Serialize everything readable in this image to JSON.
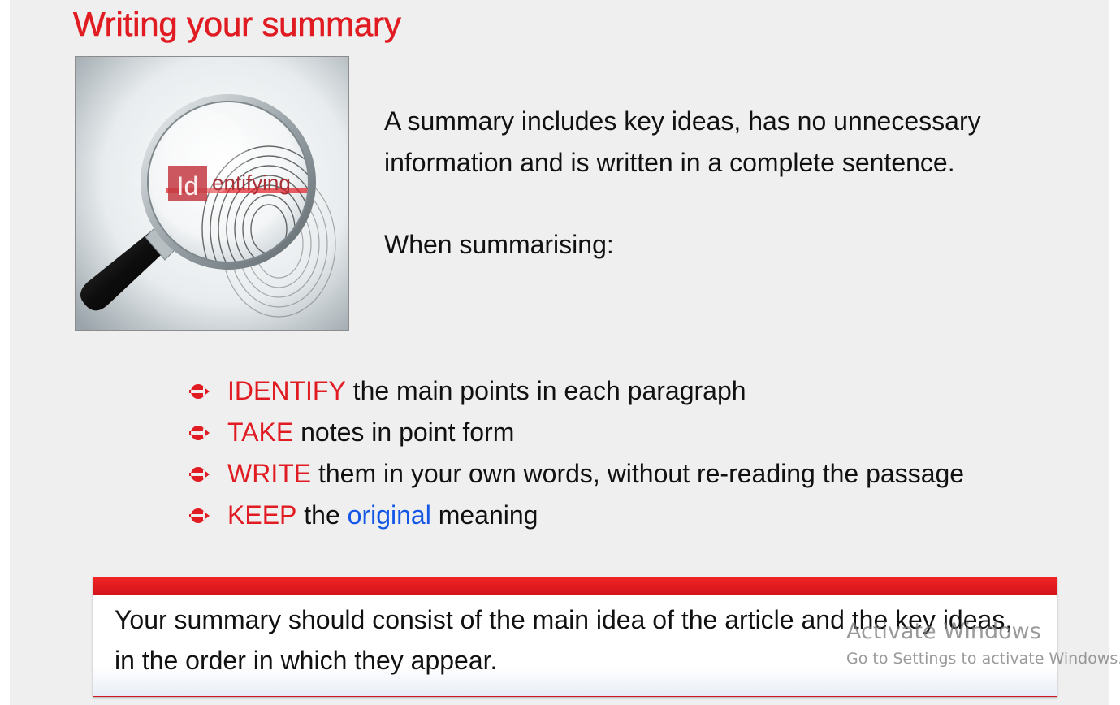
{
  "slide": {
    "title": "Writing your summary",
    "illustration": {
      "icon": "magnifying-glass-over-fingerprint",
      "caption_prefix": "Id",
      "caption_rest": "entifying"
    },
    "intro": "A summary includes key ideas, has no unnecessary information and is written in a complete sentence.",
    "lead_in": "When summarising:",
    "steps": [
      {
        "keyword": "IDENTIFY",
        "rest": " the main points in each paragraph"
      },
      {
        "keyword": "TAKE",
        "rest": " notes in point form"
      },
      {
        "keyword": "WRITE",
        "rest": " them in your own words, without re-reading the passage"
      },
      {
        "keyword": "KEEP",
        "rest_before": " the ",
        "highlight": "original",
        "rest_after": " meaning"
      }
    ],
    "note": "Your summary should consist of the main idea of the article and the key ideas, in the order in which they appear."
  },
  "watermark": {
    "title": "Activate Windows",
    "subtitle": "Go to Settings to activate Windows."
  },
  "colors": {
    "background": "#efefef",
    "accent_red": "#e11b22",
    "highlight_blue": "#1457e6",
    "text": "#111111"
  }
}
